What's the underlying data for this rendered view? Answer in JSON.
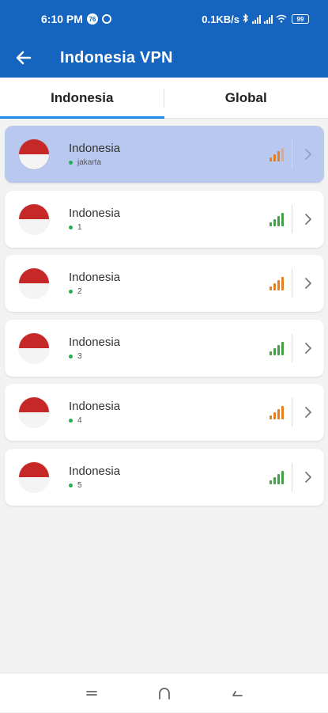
{
  "status_bar": {
    "time": "6:10 PM",
    "badge": "76",
    "speed": "0.1KB/s",
    "battery": "99"
  },
  "app_bar": {
    "title": "Indonesia VPN"
  },
  "tabs": [
    {
      "label": "Indonesia",
      "active": true
    },
    {
      "label": "Global",
      "active": false
    }
  ],
  "colors": {
    "primary": "#1565c0",
    "tab_indicator": "#1e88e5",
    "selected_card": "#b9c8ef",
    "signal_orange": "#e67e22",
    "signal_green": "#43a047",
    "online_dot": "#22b14c"
  },
  "servers": [
    {
      "name": "Indonesia",
      "location": "jakarta",
      "signal": "orange",
      "selected": true
    },
    {
      "name": "Indonesia",
      "location": "1",
      "signal": "green",
      "selected": false
    },
    {
      "name": "Indonesia",
      "location": "2",
      "signal": "orange",
      "selected": false
    },
    {
      "name": "Indonesia",
      "location": "3",
      "signal": "green",
      "selected": false
    },
    {
      "name": "Indonesia",
      "location": "4",
      "signal": "orange",
      "selected": false
    },
    {
      "name": "Indonesia",
      "location": "5",
      "signal": "green",
      "selected": false
    }
  ],
  "icons": {
    "back": "arrow-left-icon",
    "chevron": "chevron-right-icon",
    "nav_menu": "menu-icon",
    "nav_home": "home-icon",
    "nav_back": "back-icon"
  }
}
